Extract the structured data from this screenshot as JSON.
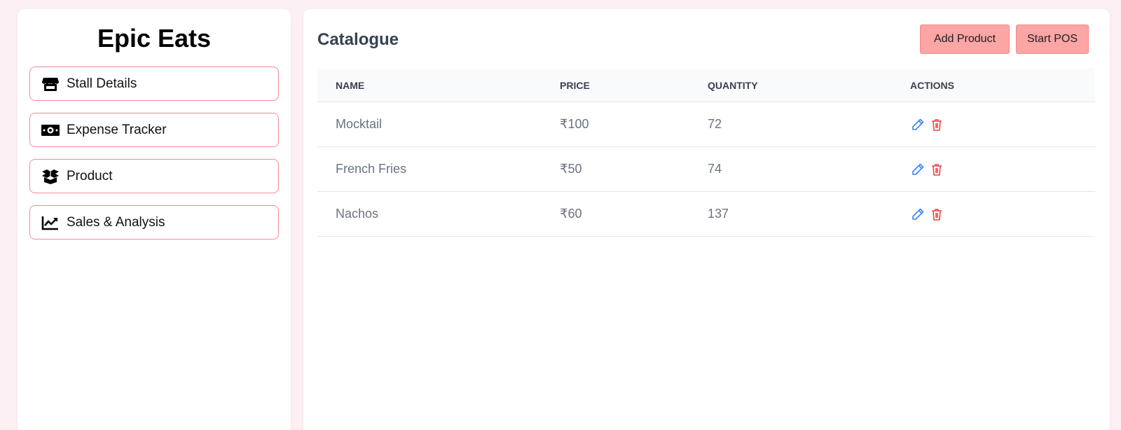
{
  "sidebar": {
    "brand": "Epic Eats",
    "items": [
      {
        "label": "Stall Details",
        "icon": "store-icon"
      },
      {
        "label": "Expense Tracker",
        "icon": "money-icon"
      },
      {
        "label": "Product",
        "icon": "open-box-icon"
      },
      {
        "label": "Sales & Analysis",
        "icon": "trend-chart-icon"
      }
    ]
  },
  "main": {
    "title": "Catalogue",
    "buttons": {
      "add_product": "Add Product",
      "start_pos": "Start POS"
    },
    "table": {
      "columns": [
        "NAME",
        "PRICE",
        "QUANTITY",
        "ACTIONS"
      ],
      "rows": [
        {
          "name": "Mocktail",
          "price": "₹100",
          "quantity": "72"
        },
        {
          "name": "French Fries",
          "price": "₹50",
          "quantity": "74"
        },
        {
          "name": "Nachos",
          "price": "₹60",
          "quantity": "137"
        }
      ]
    }
  },
  "colors": {
    "background": "#fdf0f4",
    "accent_border": "#f48b98",
    "button_fill": "#fca5a5",
    "edit_icon": "#3b82f6",
    "delete_icon": "#ef4444"
  }
}
